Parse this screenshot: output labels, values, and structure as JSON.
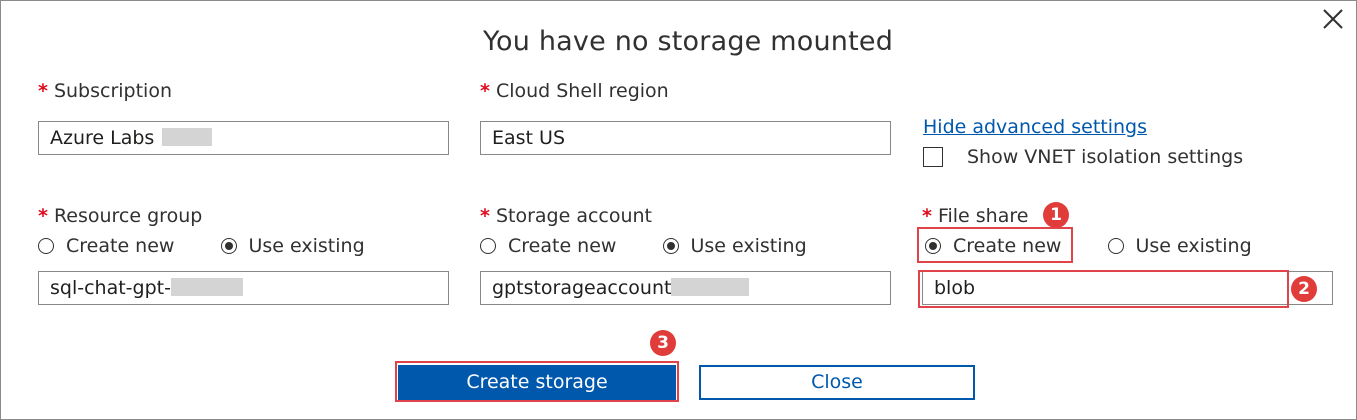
{
  "dialog": {
    "title": "You have no storage mounted",
    "close_icon": "close-icon"
  },
  "subscription": {
    "label": "Subscription",
    "required_mark": "*",
    "value": "Azure Labs"
  },
  "region": {
    "label": "Cloud Shell region",
    "required_mark": "*",
    "value": "East US"
  },
  "advanced": {
    "link_text": "Hide advanced settings",
    "vnet_label": "Show VNET isolation settings",
    "vnet_checked": false
  },
  "resource_group": {
    "label": "Resource group",
    "required_mark": "*",
    "option_new": "Create new",
    "option_existing": "Use existing",
    "selected": "Use existing",
    "value": "sql-chat-gpt-"
  },
  "storage_account": {
    "label": "Storage account",
    "required_mark": "*",
    "option_new": "Create new",
    "option_existing": "Use existing",
    "selected": "Use existing",
    "value": "gptstorageaccount"
  },
  "file_share": {
    "label": "File share",
    "required_mark": "*",
    "option_new": "Create new",
    "option_existing": "Use existing",
    "selected": "Create new",
    "value": "blob"
  },
  "callouts": {
    "one": "1",
    "two": "2",
    "three": "3",
    "color": "#e03c3a"
  },
  "buttons": {
    "create_label": "Create storage",
    "close_label": "Close",
    "primary_color": "#0058ad"
  }
}
